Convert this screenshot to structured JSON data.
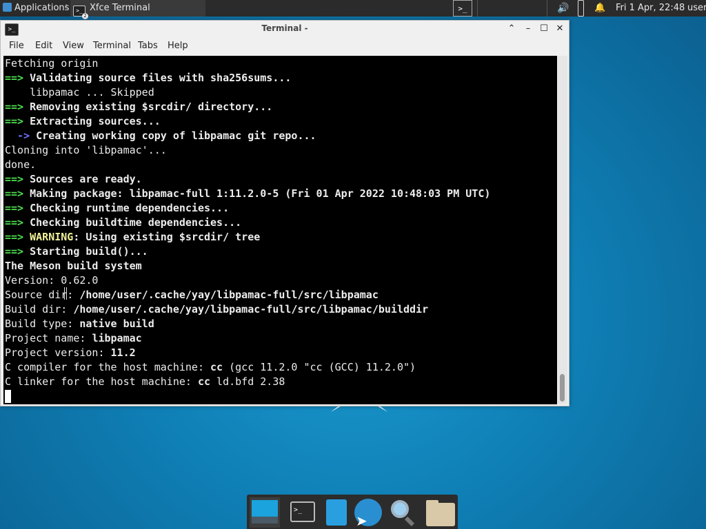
{
  "top_panel": {
    "applications_label": "Applications",
    "task_label": "Xfce Terminal",
    "task_badge": "2",
    "launcher_glyph": ">_",
    "clock": "Fri  1 Apr, 22:48",
    "user": "user",
    "icons": [
      "applications-icon",
      "terminal-icon",
      "volume-icon",
      "battery-icon",
      "notification-bell-icon"
    ]
  },
  "window": {
    "title": "Terminal -",
    "icon_glyph": ">_",
    "buttons": [
      "shade",
      "minimize",
      "maximize",
      "close"
    ],
    "menu": [
      "File",
      "Edit",
      "View",
      "Terminal",
      "Tabs",
      "Help"
    ]
  },
  "terminal": {
    "lines": [
      [
        {
          "t": "Fetching origin",
          "s": ""
        }
      ],
      [
        {
          "t": "==> ",
          "s": "g"
        },
        {
          "t": "Validating source files with sha256sums...",
          "s": "b"
        }
      ],
      [
        {
          "t": "    libpamac ... Skipped",
          "s": ""
        }
      ],
      [
        {
          "t": "==> ",
          "s": "g"
        },
        {
          "t": "Removing existing $srcdir/ directory...",
          "s": "b"
        }
      ],
      [
        {
          "t": "==> ",
          "s": "g"
        },
        {
          "t": "Extracting sources...",
          "s": "b"
        }
      ],
      [
        {
          "t": "  -> ",
          "s": "bl"
        },
        {
          "t": "Creating working copy of libpamac git repo...",
          "s": "b"
        }
      ],
      [
        {
          "t": "Cloning into 'libpamac'...",
          "s": ""
        }
      ],
      [
        {
          "t": "done.",
          "s": ""
        }
      ],
      [
        {
          "t": "==> ",
          "s": "g"
        },
        {
          "t": "Sources are ready.",
          "s": "b"
        }
      ],
      [
        {
          "t": "==> ",
          "s": "g"
        },
        {
          "t": "Making package: libpamac-full 1:11.2.0-5 (Fri 01 Apr 2022 10:48:03 PM UTC)",
          "s": "b"
        }
      ],
      [
        {
          "t": "==> ",
          "s": "g"
        },
        {
          "t": "Checking runtime dependencies...",
          "s": "b"
        }
      ],
      [
        {
          "t": "==> ",
          "s": "g"
        },
        {
          "t": "Checking buildtime dependencies...",
          "s": "b"
        }
      ],
      [
        {
          "t": "==> ",
          "s": "g"
        },
        {
          "t": "WARNING",
          "s": "y"
        },
        {
          "t": ": Using existing $srcdir/ tree",
          "s": "b"
        }
      ],
      [
        {
          "t": "==> ",
          "s": "g"
        },
        {
          "t": "Starting build()...",
          "s": "b"
        }
      ],
      [
        {
          "t": "The Meson build system",
          "s": "b"
        }
      ],
      [
        {
          "t": "Version: ",
          "s": ""
        },
        {
          "t": "0.62.0",
          "s": ""
        }
      ],
      [
        {
          "t": "Source dir: ",
          "s": ""
        },
        {
          "t": "/home/user/.cache/yay/libpamac-full/src/libpamac",
          "s": "b"
        }
      ],
      [
        {
          "t": "Build dir: ",
          "s": ""
        },
        {
          "t": "/home/user/.cache/yay/libpamac-full/src/libpamac/builddir",
          "s": "b"
        }
      ],
      [
        {
          "t": "Build type: ",
          "s": ""
        },
        {
          "t": "native build",
          "s": "b"
        }
      ],
      [
        {
          "t": "Project name: ",
          "s": ""
        },
        {
          "t": "libpamac",
          "s": "b"
        }
      ],
      [
        {
          "t": "Project version: ",
          "s": ""
        },
        {
          "t": "11.2",
          "s": "b"
        }
      ],
      [
        {
          "t": "C compiler for the host machine: ",
          "s": ""
        },
        {
          "t": "cc",
          "s": "b"
        },
        {
          "t": " (gcc 11.2.0 \"cc (GCC) 11.2.0\")",
          "s": ""
        }
      ],
      [
        {
          "t": "C linker for the host machine: ",
          "s": ""
        },
        {
          "t": "cc",
          "s": "b"
        },
        {
          "t": " ld.bfd 2.38",
          "s": ""
        }
      ]
    ],
    "colors": {
      "background": "#000000",
      "foreground": "#ededed",
      "prompt_green": "#4ee04e",
      "arrow_blue": "#6f6fff",
      "warning_yellow": "#f2f29a"
    }
  },
  "dock": {
    "items": [
      "show-desktop-icon",
      "terminal-icon",
      "file-manager-icon",
      "web-browser-icon",
      "app-finder-icon",
      "home-folder-icon"
    ]
  }
}
